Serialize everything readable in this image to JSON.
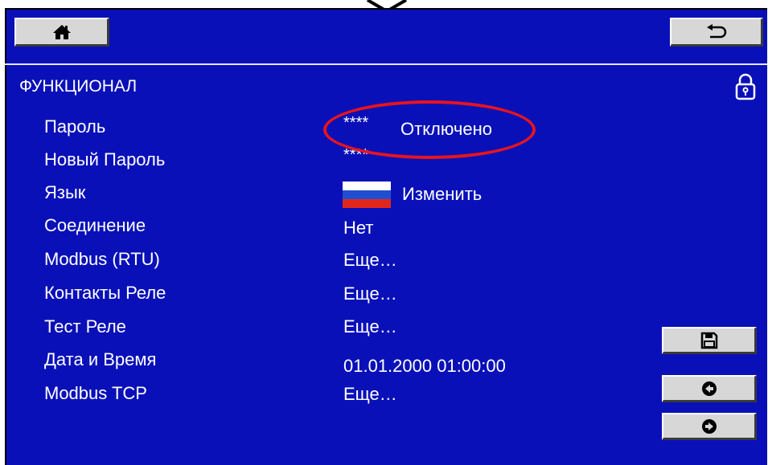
{
  "header": {
    "title": "ФУНКЦИОНАЛ"
  },
  "icons": {
    "home": "home-icon",
    "back": "return-arrow-icon",
    "lock": "padlock-icon",
    "save": "floppy-disk-icon",
    "prev": "arrow-left-circle-icon",
    "next": "arrow-right-circle-icon",
    "flag": "russia-flag-icon"
  },
  "rows": [
    {
      "label": "Пароль",
      "value": "****",
      "extra": "Отключено"
    },
    {
      "label": "Новый Пароль",
      "value": "****"
    },
    {
      "label": "Язык",
      "value": "Изменить"
    },
    {
      "label": "Соединение",
      "value": "Нет"
    },
    {
      "label": "Modbus (RTU)",
      "value": "Еще…"
    },
    {
      "label": "Контакты Реле",
      "value": "Еще…"
    },
    {
      "label": "Тест Реле",
      "value": "Еще…"
    },
    {
      "label": "Дата и Время",
      "value": "01.01.2000  01:00:00"
    },
    {
      "label": "Modbus TCP",
      "value": "Еще…"
    }
  ],
  "colors": {
    "background": "#0a10b8",
    "text": "#ffffff",
    "button": "#d7d7d7",
    "highlight": "#e8141c",
    "flag_white": "#ffffff",
    "flag_blue": "#1f4fd0",
    "flag_red": "#e1261c"
  }
}
